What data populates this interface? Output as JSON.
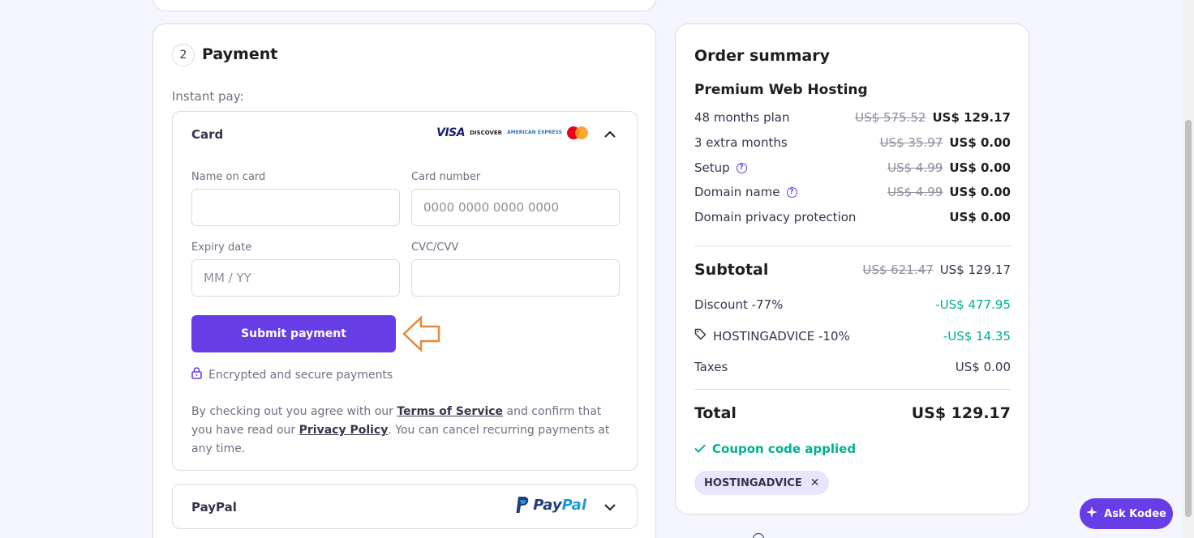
{
  "payment": {
    "step_number": "2",
    "title": "Payment",
    "instant_pay_label": "Instant pay:",
    "card": {
      "title": "Card",
      "brands": [
        "VISA",
        "DISCOVER",
        "AMERICAN EXPRESS",
        "Mastercard"
      ],
      "name_label": "Name on card",
      "name_value": "",
      "card_number_label": "Card number",
      "card_number_placeholder": "0000 0000 0000 0000",
      "expiry_label": "Expiry date",
      "expiry_placeholder": "MM / YY",
      "cvc_label": "CVC/CVV",
      "cvc_value": "",
      "submit_label": "Submit payment",
      "secure_text": "Encrypted and secure payments",
      "terms_pre": "By checking out you agree with our ",
      "terms_link": "Terms of Service",
      "terms_mid": " and confirm that you have read our ",
      "privacy_link": "Privacy Policy",
      "terms_post": ". You can cancel recurring payments at any time."
    },
    "paypal": {
      "title": "PayPal",
      "logo_text_a": "Pay",
      "logo_text_b": "Pal"
    }
  },
  "summary": {
    "title": "Order summary",
    "product": "Premium Web Hosting",
    "lines": [
      {
        "label": "48 months plan",
        "old": "US$ 575.52",
        "new": "US$ 129.17",
        "help": false
      },
      {
        "label": "3 extra months",
        "old": "US$ 35.97",
        "new": "US$ 0.00",
        "help": false
      },
      {
        "label": "Setup",
        "old": "US$ 4.99",
        "new": "US$ 0.00",
        "help": true
      },
      {
        "label": "Domain name",
        "old": "US$ 4.99",
        "new": "US$ 0.00",
        "help": true
      },
      {
        "label": "Domain privacy protection",
        "old": "",
        "new": "US$ 0.00",
        "help": false
      }
    ],
    "subtotal_label": "Subtotal",
    "subtotal_old": "US$ 621.47",
    "subtotal_new": "US$ 129.17",
    "discount_label": "Discount -77%",
    "discount_value": "-US$ 477.95",
    "coupon_line_label": "HOSTINGADVICE -10%",
    "coupon_line_value": "-US$ 14.35",
    "taxes_label": "Taxes",
    "taxes_value": "US$ 0.00",
    "total_label": "Total",
    "total_value": "US$ 129.17",
    "coupon_applied": "Coupon code applied",
    "coupon_chip": "HOSTINGADVICE"
  },
  "assistant": {
    "label": "Ask Kodee"
  },
  "colors": {
    "accent": "#673de6",
    "success": "#00b090",
    "arrow": "#e8883a",
    "background": "#f4f5ff"
  }
}
